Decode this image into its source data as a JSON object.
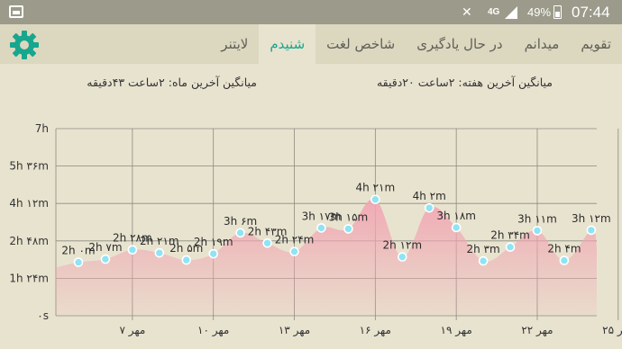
{
  "status_bar": {
    "battery": "49%",
    "network": "4G",
    "time": "07:44",
    "icons": [
      "gallery-icon",
      "mute-icon",
      "signal-icon",
      "battery-icon"
    ]
  },
  "toolbar": {
    "tabs": [
      {
        "label": "تقویم",
        "active": false
      },
      {
        "label": "میدانم",
        "active": false
      },
      {
        "label": "در حال یادگیری",
        "active": false
      },
      {
        "label": "شاخص لغت",
        "active": false
      },
      {
        "label": "شنیدم",
        "active": true
      },
      {
        "label": "لایتنر",
        "active": false
      }
    ],
    "settings_icon": "gear-icon"
  },
  "colors": {
    "accent": "#17a68e",
    "area_fill": "#f1a7b3",
    "marker": "#8ee4f5",
    "background": "#e8e3cf"
  },
  "summary": {
    "week": "میانگین آخرین هفته: ۲ساعت  ۲۰دقیقه",
    "month": "میانگین آخرین ماه: ۲ساعت  ۴۳دقیقه"
  },
  "chart_data": {
    "type": "area",
    "y_ticks": [
      "۰s",
      "1h ۲۴m",
      "2h ۴۸m",
      "4h ۱۲m",
      "5h ۳۶m",
      "7h"
    ],
    "y_range_minutes": [
      0,
      420
    ],
    "x_ticks": [
      "۷ مهر",
      "۱۰ مهر",
      "۱۳ مهر",
      "۱۶ مهر",
      "۱۹ مهر",
      "۲۲ مهر",
      "۲۵ مهر"
    ],
    "x_tick_days": [
      7,
      10,
      13,
      16,
      19,
      22,
      25
    ],
    "points": [
      {
        "day": 5,
        "minutes": 120,
        "label": "2h ۰m"
      },
      {
        "day": 6,
        "minutes": 127,
        "label": "2h ۷m"
      },
      {
        "day": 7,
        "minutes": 148,
        "label": "2h ۲۸m"
      },
      {
        "day": 8,
        "minutes": 141,
        "label": "2h ۲۱m"
      },
      {
        "day": 9,
        "minutes": 125,
        "label": "2h ۵m"
      },
      {
        "day": 10,
        "minutes": 139,
        "label": "2h ۱۹m"
      },
      {
        "day": 11,
        "minutes": 186,
        "label": "3h ۶m"
      },
      {
        "day": 12,
        "minutes": 163,
        "label": "2h ۴۳m"
      },
      {
        "day": 13,
        "minutes": 144,
        "label": "2h ۲۴m"
      },
      {
        "day": 14,
        "minutes": 197,
        "label": "3h ۱۷m"
      },
      {
        "day": 15,
        "minutes": 195,
        "label": "3h ۱۵m"
      },
      {
        "day": 16,
        "minutes": 261,
        "label": "4h ۲۱m"
      },
      {
        "day": 17,
        "minutes": 132,
        "label": "2h ۱۲m"
      },
      {
        "day": 18,
        "minutes": 242,
        "label": "4h ۲m"
      },
      {
        "day": 19,
        "minutes": 198,
        "label": "3h ۱۸m"
      },
      {
        "day": 20,
        "minutes": 123,
        "label": "2h ۳m"
      },
      {
        "day": 21,
        "minutes": 154,
        "label": "2h ۳۴m"
      },
      {
        "day": 22,
        "minutes": 191,
        "label": "3h ۱۱m"
      },
      {
        "day": 23,
        "minutes": 124,
        "label": "2h ۴m"
      },
      {
        "day": 24,
        "minutes": 192,
        "label": "3h ۱۲m"
      }
    ]
  }
}
